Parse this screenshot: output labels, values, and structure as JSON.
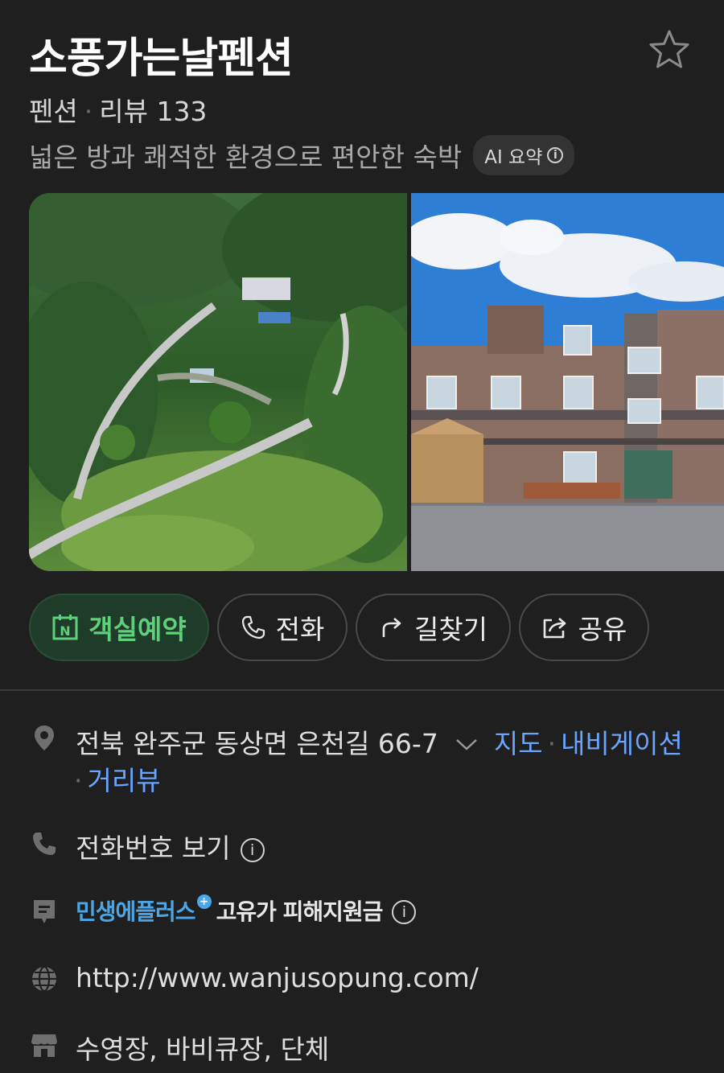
{
  "header": {
    "title": "소풍가는날펜션",
    "category": "펜션",
    "dot": "·",
    "review_label": "리뷰 133",
    "summary": "넓은 방과 쾌적한 환경으로 편안한 숙박",
    "ai_badge": "AI 요약",
    "favorite_icon": "star-icon"
  },
  "actions": {
    "reserve": "객실예약",
    "call": "전화",
    "directions": "길찾기",
    "share": "공유"
  },
  "details": {
    "address": "전북 완주군 동상면 은천길 66-7",
    "map_link": "지도",
    "navigation_link": "내비게이션",
    "street_view_link": "거리뷰",
    "phone": "전화번호 보기",
    "gov_program_1": "민생에플러스",
    "gov_program_2": "고유가 피해지원금",
    "website": "http://www.wanjusopung.com/",
    "amenities": "수영장, 바비큐장, 단체"
  },
  "colors": {
    "background": "#1f1f1f",
    "reserve_green": "#5fd07a",
    "link_blue": "#6aa4ff"
  }
}
